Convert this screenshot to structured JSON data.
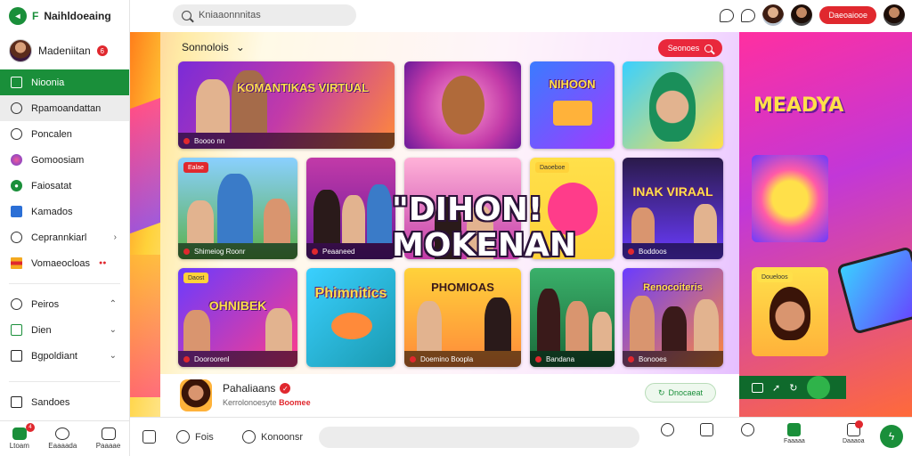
{
  "app": {
    "brand_title": "Naihldoeaing",
    "brand_tag": "F",
    "profile_name": "Madeniitan",
    "profile_badge": "6"
  },
  "sidebar": {
    "items": [
      {
        "label": "Nioonia",
        "icon": "box-icon",
        "active": true
      },
      {
        "label": "Rpamoandattan",
        "icon": "chat-icon",
        "hover": true
      },
      {
        "label": "Poncalen",
        "icon": "circle-icon"
      },
      {
        "label": "Gomoosiam",
        "icon": "palette-icon"
      },
      {
        "label": "Faiosatat",
        "icon": "green-dot-icon"
      },
      {
        "label": "Kamados",
        "icon": "calendar-icon"
      },
      {
        "label": "Ceprannkiarl",
        "icon": "shield-icon"
      },
      {
        "label": "Vomaeocloas",
        "icon": "stripes-icon",
        "badge": "●●"
      }
    ],
    "group2": [
      {
        "label": "Peiros"
      },
      {
        "label": "Dien"
      },
      {
        "label": "Bgpoldiant"
      }
    ],
    "footer_item": "Sandoes",
    "bottom_tabs": [
      {
        "label": "Ltoam",
        "badge": "4"
      },
      {
        "label": "Eaaaada"
      },
      {
        "label": "Paaaae"
      }
    ]
  },
  "topbar": {
    "search_placeholder": "Kniaaonnnitas",
    "pill_label": "Daeoaiooe"
  },
  "main": {
    "section_title": "Sonnolois",
    "search_pill": "Seonoes",
    "overlay_title_line1": "\"DIHON!",
    "overlay_title_line2": "MOKENAN",
    "cards": [
      {
        "big": "KOMANTIKAS VIRTUAL",
        "label": "Boooo nn"
      },
      {
        "big": "",
        "label": ""
      },
      {
        "big": "NIHOON",
        "label": ""
      },
      {
        "big": "",
        "label": ""
      },
      {
        "tag": "Ealae",
        "label": "Shimeiog Roonr"
      },
      {
        "tag": "",
        "label": "Peaaneed"
      },
      {
        "tag": "",
        "label": ""
      },
      {
        "tag": "Daoeboe",
        "label": ""
      },
      {
        "big": "INAK VIRAAL",
        "label": "Boddoos"
      },
      {
        "tag": "Daost",
        "big": "OHNIBEK",
        "label": "Dooroorenl"
      },
      {
        "big": "Phimnitics",
        "label": ""
      },
      {
        "big": "PHOMIOAS",
        "label": "Doemino Boopla"
      },
      {
        "big": "",
        "label": "Bandana"
      },
      {
        "big": "Renocoiteris",
        "label": "Bonooes"
      }
    ],
    "bottom": {
      "title": "Pahaliaans",
      "subtitle": "Kerrolonoesyte",
      "subtitle_accent": "Boomee",
      "button": "Dnocaeat"
    }
  },
  "right": {
    "title": "MEADYA",
    "card2_tag": "Doueloos"
  },
  "dock": {
    "home_label": "",
    "item1": "Fois",
    "item2": "Konoonsr",
    "icons": [
      {
        "label": ""
      },
      {
        "label": ""
      },
      {
        "label": ""
      },
      {
        "label": "Faaaaa"
      },
      {
        "label": "Daaaoa"
      }
    ]
  }
}
